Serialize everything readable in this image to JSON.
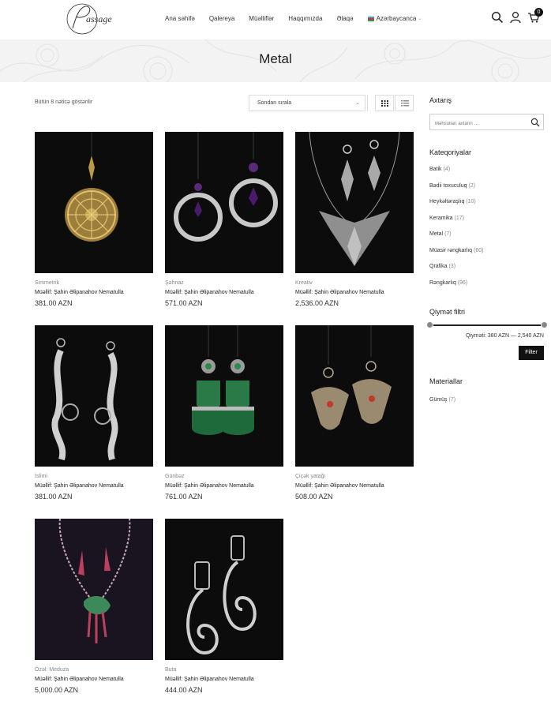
{
  "header": {
    "nav": [
      "Ana səhifə",
      "Qalereya",
      "Müəlliflər",
      "Haqqımızda",
      "Əlaqə"
    ],
    "language": "Azərbaycanca",
    "cart_count": "0"
  },
  "banner": {
    "title": "Metal"
  },
  "toolbar": {
    "result_count": "Bütün 8 nəticə göstərilir",
    "sort_selected": "Sondan sırala"
  },
  "products": [
    {
      "category": "Simmetrik",
      "author": "Müəllif: Şahin Əlipanahov Nematulla",
      "price": "381.00 AZN"
    },
    {
      "category": "Şəhnaz",
      "author": "Müəllif: Şahin Əlipanahov Nematulla",
      "price": "571.00 AZN"
    },
    {
      "category": "Kreativ",
      "author": "Müəllif: Şahin Əlipanahov Nematulla",
      "price": "2,536.00 AZN"
    },
    {
      "category": "İslimi",
      "author": "Müəllif: Şahin Əlipanahov Nematulla",
      "price": "381.00 AZN"
    },
    {
      "category": "Günbəz",
      "author": "Müəllif: Şahin Əlipanahov Nematulla",
      "price": "761.00 AZN"
    },
    {
      "category": "Çiçək yatağı",
      "author": "Müəllif: Şahin Əlipanahov Nematulla",
      "price": "508.00 AZN"
    },
    {
      "category": "Özəl: Meduza",
      "author": "Müəllif: Şahin Əlipanahov Nematulla",
      "price": "5,000.00 AZN"
    },
    {
      "category": "Buta",
      "author": "Müəllif: Şahin Əlipanahov Nematulla",
      "price": "444.00 AZN"
    }
  ],
  "sidebar": {
    "search_title": "Axtarış",
    "search_placeholder": "Məhsulları axtarın …",
    "categories_title": "Kateqoriyalar",
    "categories": [
      {
        "name": "Batik",
        "count": "(4)"
      },
      {
        "name": "Bədii toxuculuq",
        "count": "(2)"
      },
      {
        "name": "Heykəltəraşlıq",
        "count": "(10)"
      },
      {
        "name": "Keramika",
        "count": "(17)"
      },
      {
        "name": "Metal",
        "count": "(7)"
      },
      {
        "name": "Müasir rəngkarlıq",
        "count": "(60)"
      },
      {
        "name": "Qrafika",
        "count": "(3)"
      },
      {
        "name": "Rəngkarlıq",
        "count": "(96)"
      }
    ],
    "price_filter_title": "Qiymət filtri",
    "price_range": "Qiyməti: 380 AZN — 2,540 AZN",
    "filter_button": "Filter",
    "materials_title": "Materiallar",
    "materials": [
      {
        "name": "Gümüş",
        "count": "(7)"
      }
    ]
  },
  "colors": {
    "accent": "#111111",
    "image_bg": "#0d0c0d",
    "banner_bg": "#f3f3f3"
  }
}
